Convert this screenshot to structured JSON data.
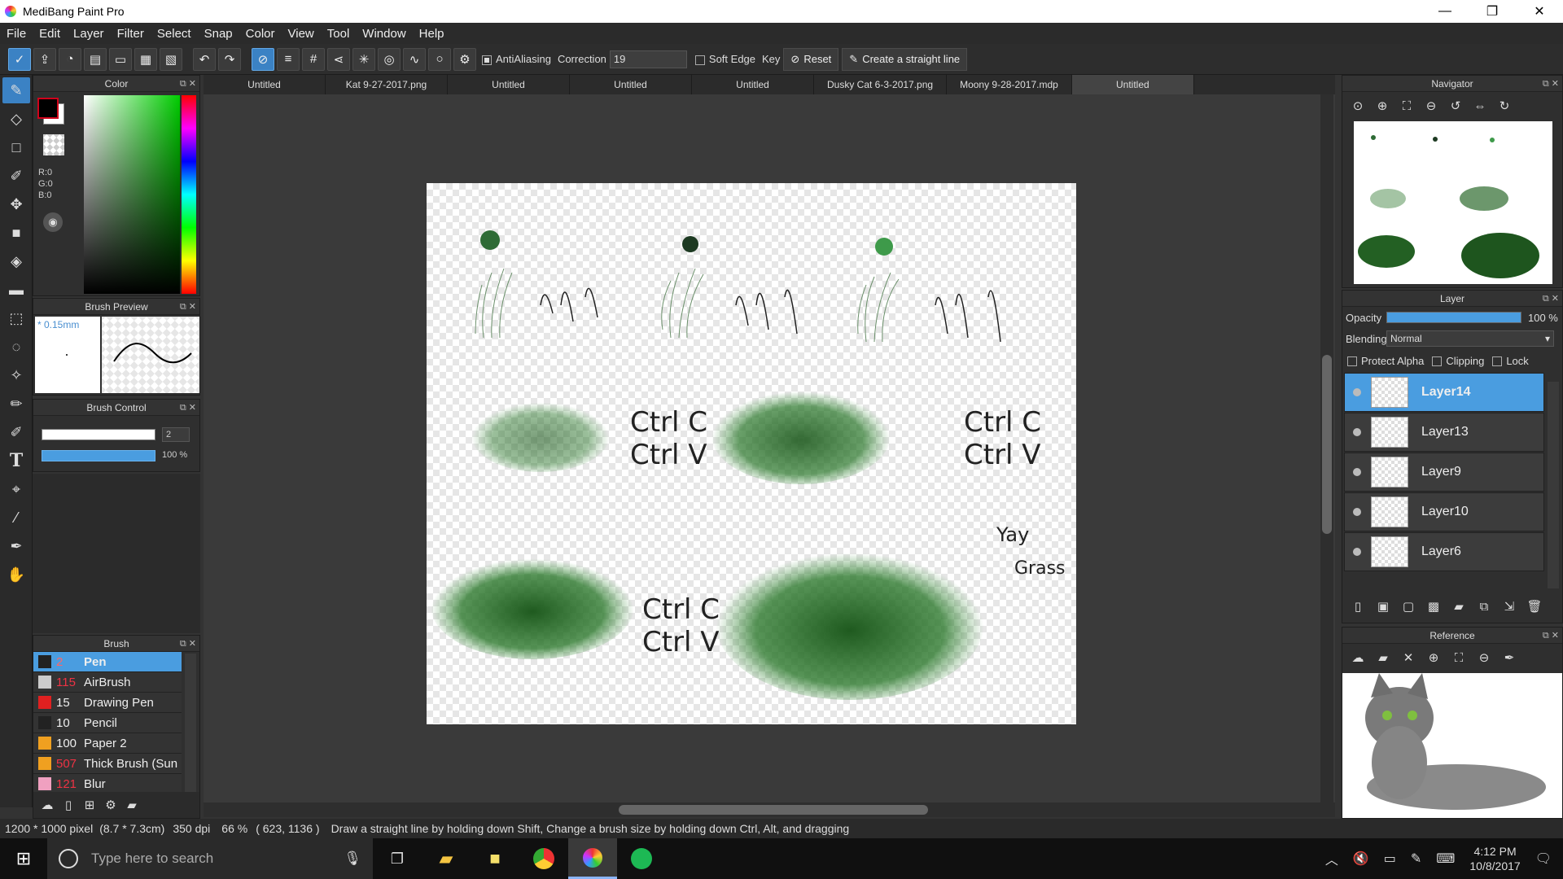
{
  "window": {
    "title": "MediBang Paint Pro",
    "min": "—",
    "max": "❐",
    "close": "✕"
  },
  "menu": [
    "File",
    "Edit",
    "Layer",
    "Filter",
    "Select",
    "Snap",
    "Color",
    "View",
    "Tool",
    "Window",
    "Help"
  ],
  "toolbar": {
    "antialiasing_label": "AntiAliasing",
    "correction_label": "Correction",
    "correction_value": "19",
    "soft_edge_label": "Soft Edge",
    "key_label": "Key",
    "reset_label": "Reset",
    "straight_line_label": "Create a straight line"
  },
  "tabs": [
    "Untitled",
    "Kat 9-27-2017.png",
    "Untitled",
    "Untitled",
    "Untitled",
    "Dusky Cat 6-3-2017.png",
    "Moony 9-28-2017.mdp",
    "Untitled"
  ],
  "color_panel": {
    "title": "Color",
    "r": "R:0",
    "g": "G:0",
    "b": "B:0",
    "fg": "#d0021b",
    "bg": "#ffffff"
  },
  "brush_preview": {
    "title": "Brush Preview",
    "size": "* 0.15mm"
  },
  "brush_control": {
    "title": "Brush Control",
    "size": "2",
    "opacity": "100 %"
  },
  "brush_panel": {
    "title": "Brush",
    "items": [
      {
        "num": "2",
        "name": "Pen",
        "color": "#222222"
      },
      {
        "num": "115",
        "name": "AirBrush",
        "color": "#cccccc"
      },
      {
        "num": "15",
        "name": "Drawing Pen",
        "color": "#e02020"
      },
      {
        "num": "10",
        "name": "Pencil",
        "color": "#222222"
      },
      {
        "num": "100",
        "name": "Paper 2",
        "color": "#f0a020"
      },
      {
        "num": "507",
        "name": "Thick Brush (Sun",
        "color": "#f0a020"
      },
      {
        "num": "121",
        "name": "Blur",
        "color": "#f0a0c0"
      }
    ]
  },
  "navigator": {
    "title": "Navigator"
  },
  "layer_panel": {
    "title": "Layer",
    "opacity_label": "Opacity",
    "opacity_value": "100 %",
    "opacity_fraction": 1.0,
    "blending_label": "Blending",
    "blending_value": "Normal",
    "protect_alpha": "Protect Alpha",
    "clipping": "Clipping",
    "lock": "Lock",
    "layers": [
      "Layer14",
      "Layer13",
      "Layer9",
      "Layer10",
      "Layer6"
    ]
  },
  "reference": {
    "title": "Reference"
  },
  "canvas_text": {
    "ctrl1": "Ctrl C",
    "ctrl2": "Ctrl V",
    "yay": "Yay",
    "grass": "Grass"
  },
  "status": {
    "size": "1200 * 1000 pixel",
    "cm": "(8.7 * 7.3cm)",
    "dpi": "350 dpi",
    "zoom": "66 %",
    "coords": "( 623, 1136 )",
    "hint": "Draw a straight line by holding down Shift, Change a brush size by holding down Ctrl, Alt, and dragging"
  },
  "taskbar": {
    "search_placeholder": "Type here to search",
    "time": "4:12 PM",
    "date": "10/8/2017"
  }
}
